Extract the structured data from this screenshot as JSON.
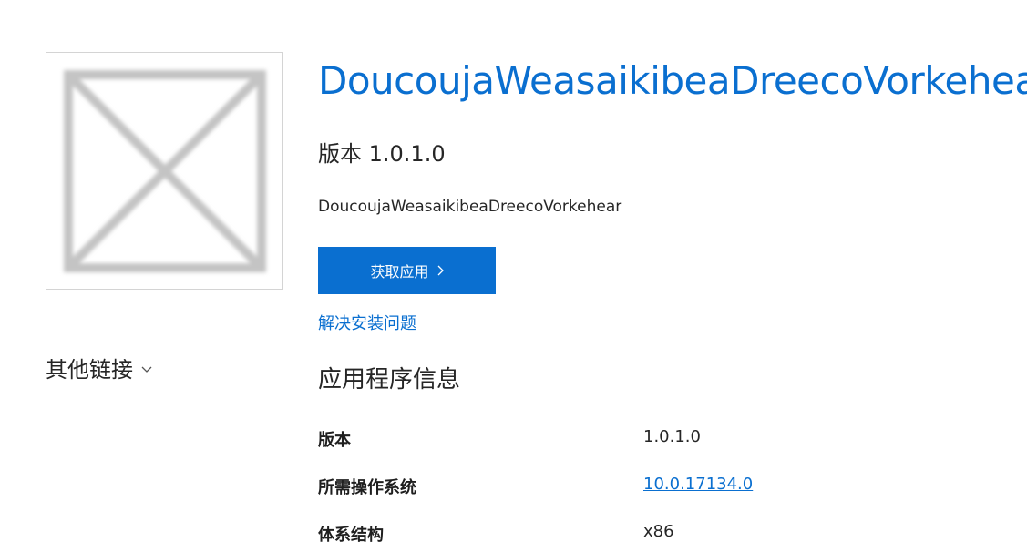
{
  "app": {
    "title": "DoucoujaWeasaikibeaDreecoVorkehear",
    "version_heading": "版本 1.0.1.0",
    "publisher": "DoucoujaWeasaikibeaDreecoVorkehear",
    "image_icon": "placeholder-image-icon"
  },
  "actions": {
    "get_app_label": "获取应用",
    "troubleshoot_label": "解决安装问题"
  },
  "sidebar": {
    "other_links_label": "其他链接",
    "chevron_icon": "chevron-down-icon"
  },
  "info": {
    "heading": "应用程序信息",
    "rows": [
      {
        "label": "版本",
        "value": "1.0.1.0",
        "is_link": false
      },
      {
        "label": "所需操作系统",
        "value": "10.0.17134.0",
        "is_link": true
      },
      {
        "label": "体系结构",
        "value": "x86",
        "is_link": false
      }
    ]
  },
  "colors": {
    "accent": "#0a6fd0",
    "text": "#262626",
    "placeholder_gray": "#c4c4c4"
  }
}
